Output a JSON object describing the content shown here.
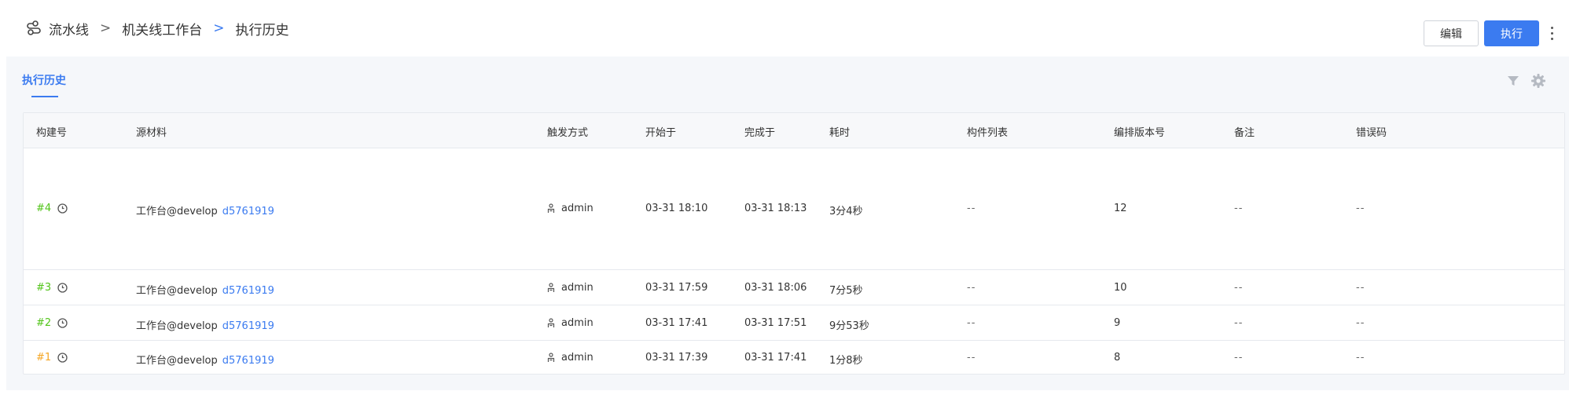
{
  "breadcrumb": {
    "items": [
      "流水线",
      "机关线工作台",
      "执行历史"
    ],
    "separator": ">"
  },
  "header_actions": {
    "edit_label": "编辑",
    "run_label": "执行"
  },
  "tabs": [
    {
      "label": "执行历史",
      "active": true
    }
  ],
  "table": {
    "columns": [
      "构建号",
      "源材料",
      "触发方式",
      "开始于",
      "完成于",
      "耗时",
      "构件列表",
      "编排版本号",
      "备注",
      "错误码"
    ],
    "rows": [
      {
        "build": "#4",
        "build_color": "#52c41a",
        "source": "工作台@develop",
        "commit": "d5761919",
        "trigger": "admin",
        "start": "03-31 18:10",
        "end": "03-31 18:13",
        "duration": "3分4秒",
        "artifacts": "--",
        "version": "12",
        "note": "--",
        "error": "--"
      },
      {
        "build": "#3",
        "build_color": "#52c41a",
        "source": "工作台@develop",
        "commit": "d5761919",
        "trigger": "admin",
        "start": "03-31 17:59",
        "end": "03-31 18:06",
        "duration": "7分5秒",
        "artifacts": "--",
        "version": "10",
        "note": "--",
        "error": "--"
      },
      {
        "build": "#2",
        "build_color": "#52c41a",
        "source": "工作台@develop",
        "commit": "d5761919",
        "trigger": "admin",
        "start": "03-31 17:41",
        "end": "03-31 17:51",
        "duration": "9分53秒",
        "artifacts": "--",
        "version": "9",
        "note": "--",
        "error": "--"
      },
      {
        "build": "#1",
        "build_color": "#f5a623",
        "source": "工作台@develop",
        "commit": "d5761919",
        "trigger": "admin",
        "start": "03-31 17:39",
        "end": "03-31 17:41",
        "duration": "1分8秒",
        "artifacts": "--",
        "version": "8",
        "note": "--",
        "error": "--"
      }
    ]
  },
  "colors": {
    "accent": "#3b7bf0",
    "success": "#52c41a",
    "warning": "#f5a623"
  },
  "icons": [
    "pipeline-logo-icon",
    "filter-icon",
    "gear-icon",
    "clock-icon",
    "user-icon",
    "more-vertical-icon"
  ]
}
